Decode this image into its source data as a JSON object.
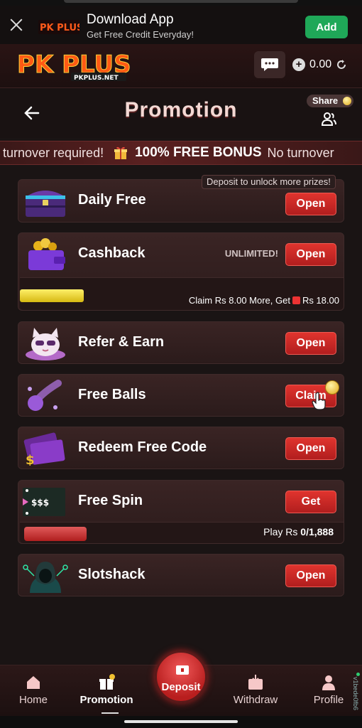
{
  "download_banner": {
    "title": "Download App",
    "subtitle": "Get Free Credit Everyday!",
    "add_label": "Add",
    "logo_text": "PK PLUS"
  },
  "header": {
    "brand": "PK PLUS",
    "brand_sub": "PKPLUS.NET",
    "balance": "0.00"
  },
  "page": {
    "title": "Promotion",
    "share_label": "Share"
  },
  "marquee": {
    "text_before": "turnover required!",
    "bonus": "100% FREE BONUS",
    "text_after": "No turnover"
  },
  "tooltip": "Deposit to unlock more prizes!",
  "promotions": {
    "daily_free": {
      "title": "Daily Free",
      "button": "Open"
    },
    "cashback": {
      "title": "Cashback",
      "badge": "UNLIMITED!",
      "button": "Open",
      "progress_prefix": "Claim Rs 8.00 More, Get",
      "progress_suffix": "Rs 18.00"
    },
    "refer": {
      "title": "Refer & Earn",
      "button": "Open"
    },
    "free_balls": {
      "title": "Free Balls",
      "button": "Claim"
    },
    "redeem": {
      "title": "Redeem Free Code",
      "button": "Open"
    },
    "free_spin": {
      "title": "Free Spin",
      "button": "Get",
      "img_text": "$$$",
      "progress_prefix": "Play Rs",
      "progress_value": "0/1,888"
    },
    "slotshack": {
      "title": "Slotshack",
      "button": "Open"
    }
  },
  "nav": {
    "home": "Home",
    "promotion": "Promotion",
    "deposit": "Deposit",
    "withdraw": "Withdraw",
    "profile": "Profile"
  },
  "version": "v1bede0fb6",
  "colors": {
    "accent_red": "#d82a28",
    "add_green": "#1fa858",
    "progress_yellow": "#e8cc20"
  }
}
